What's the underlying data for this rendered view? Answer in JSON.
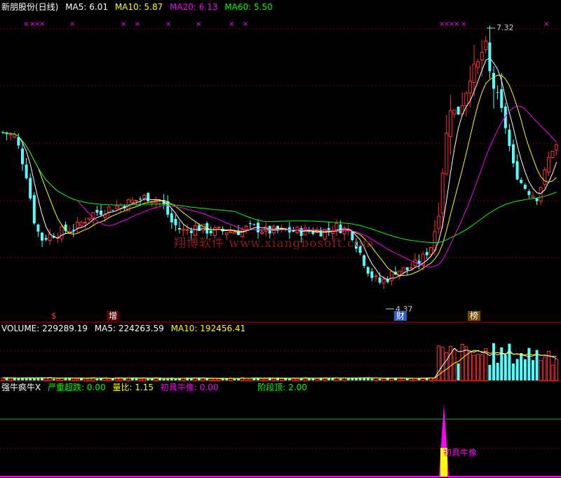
{
  "price_panel": {
    "title": "新朋股份(日线)",
    "ma5_label": "MA5: 6.01",
    "ma10_label": "MA10: 5.87",
    "ma20_label": "MA20: 6.13",
    "ma60_label": "MA60: 5.50",
    "high_label": "7.32",
    "low_label": "4.37",
    "watermark": "翔博软件 www.xiangbosoft.com",
    "event_tags": [
      "$",
      "增",
      "财",
      "榜"
    ],
    "signal_marker": "×",
    "colors": {
      "ma5": "#ffffff",
      "ma10": "#ffff00",
      "ma20": "#ff00ff",
      "ma60": "#00ff00",
      "up": "#ff3232",
      "down": "#54ffff",
      "grid": "#7a0000"
    }
  },
  "volume_panel": {
    "volume_label": "VOLUME: 229289.19",
    "ma5_label": "MA5: 224263.59",
    "ma10_label": "MA10: 192456.41"
  },
  "indicator_panel": {
    "name": "强牛疯牛X",
    "severe_drop_label": "严重超跌: 0.00",
    "volume_ratio_label": "量比: 1.15",
    "initial_bull_label": "初具牛像: 0.00",
    "stage_top_label": "阶段顶: 2.00",
    "spike_label": "初具牛像"
  }
}
